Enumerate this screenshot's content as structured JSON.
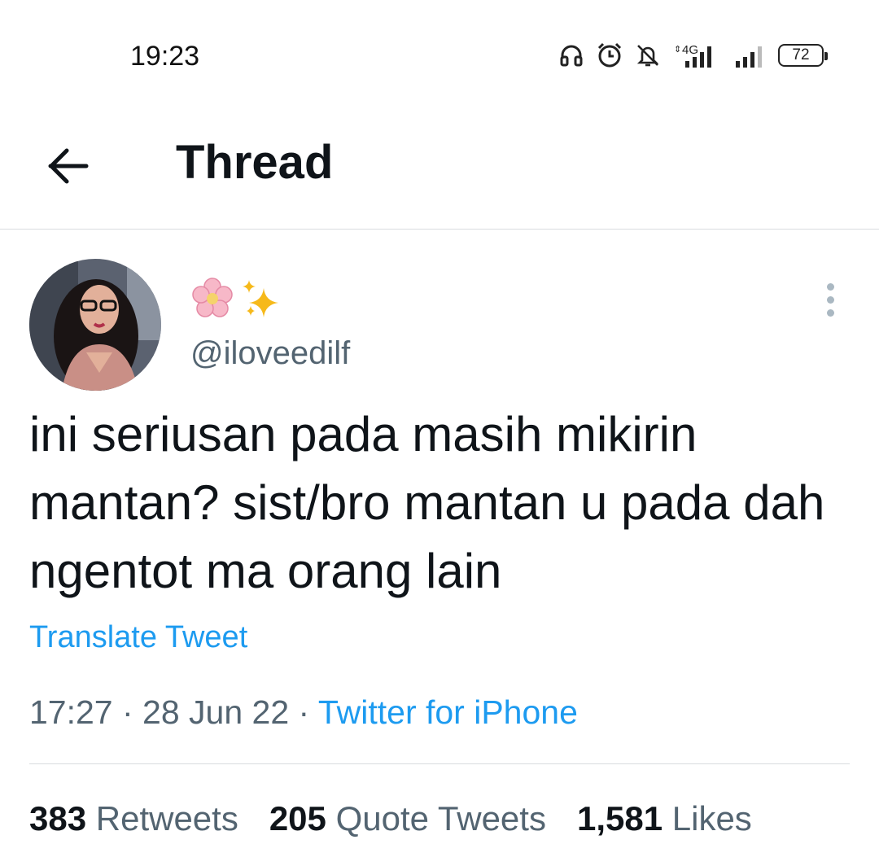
{
  "status_bar": {
    "time": "19:23",
    "network_label": "4G",
    "battery": "72",
    "icons": [
      "headphones-icon",
      "alarm-icon",
      "bell-off-icon",
      "signal-4g-icon",
      "signal-icon",
      "battery-icon"
    ]
  },
  "header": {
    "title": "Thread",
    "back_icon": "arrow-left-icon"
  },
  "tweet": {
    "display_name": "🌸✨",
    "handle": "@iloveedilf",
    "text": "ini seriusan pada masih mikirin mantan? sist/bro mantan u pada dah ngentot ma orang lain",
    "translate_label": "Translate Tweet",
    "time": "17:27",
    "separator": " · ",
    "date": "28 Jun 22",
    "source": "Twitter for iPhone",
    "more_icon": "more-vertical-icon"
  },
  "stats": [
    {
      "count": "383",
      "label": "Retweets"
    },
    {
      "count": "205",
      "label": "Quote Tweets"
    },
    {
      "count": "1,581",
      "label": "Likes"
    }
  ],
  "colors": {
    "link": "#1d9bf0",
    "secondary_text": "#536471",
    "primary_text": "#0f1419",
    "divider": "#d9dcdf"
  }
}
